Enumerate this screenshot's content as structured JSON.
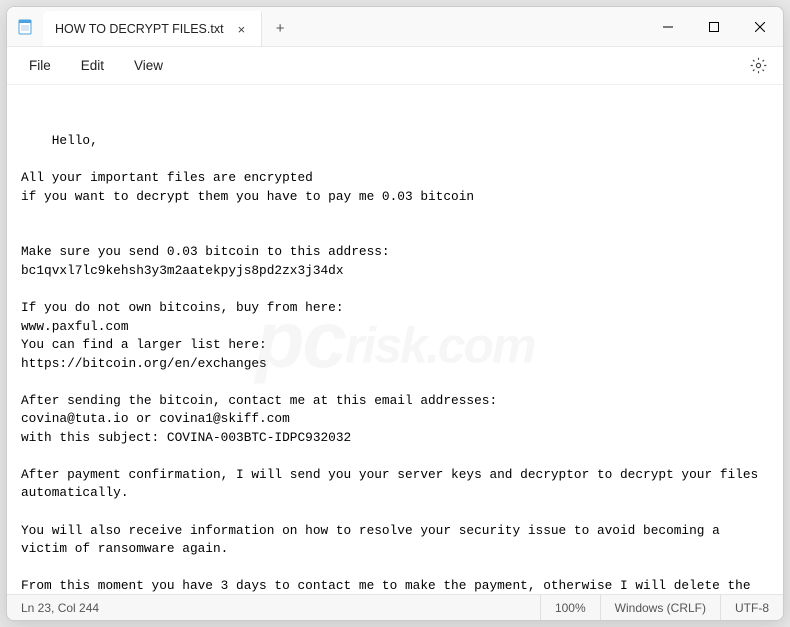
{
  "titlebar": {
    "tab_title": "HOW TO DECRYPT FILES.txt",
    "close_tab": "×",
    "new_tab": "+"
  },
  "menu": {
    "file": "File",
    "edit": "Edit",
    "view": "View"
  },
  "content_text": "Hello,\n\nAll your important files are encrypted\nif you want to decrypt them you have to pay me 0.03 bitcoin\n\n\nMake sure you send 0.03 bitcoin to this address:\nbc1qvxl7lc9kehsh3y3m2aatekpyjs8pd2zx3j34dx\n\nIf you do not own bitcoins, buy from here:\nwww.paxful.com\nYou can find a larger list here:\nhttps://bitcoin.org/en/exchanges\n\nAfter sending the bitcoin, contact me at this email addresses:\ncovina@tuta.io or covina1@skiff.com\nwith this subject: COVINA-003BTC-IDPC932032\n\nAfter payment confirmation, I will send you your server keys and decryptor to decrypt your files automatically.\n\nYou will also receive information on how to resolve your security issue to avoid becoming a victim of ransomware again.\n\nFrom this moment you have 3 days to contact me to make the payment, otherwise I will delete the keys, and be sure that no one will be able to decrypt your files without the original keys, you can try but you will lose your time and your files.",
  "status": {
    "position": "Ln 23, Col 244",
    "zoom": "100%",
    "line_ending": "Windows (CRLF)",
    "encoding": "UTF-8"
  },
  "watermark": {
    "pc": "pc",
    "risk": "risk",
    "com": ".com"
  }
}
